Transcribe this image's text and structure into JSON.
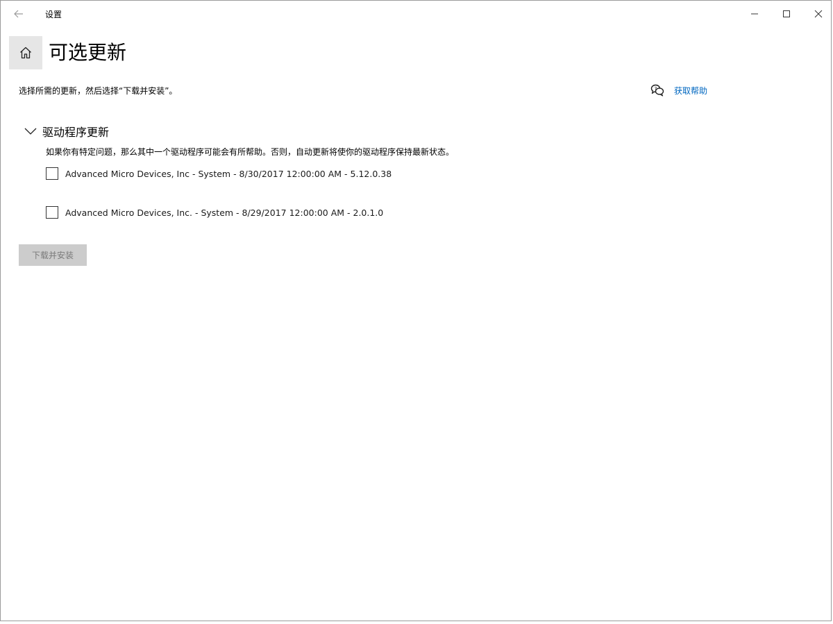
{
  "window": {
    "app_title": "设置"
  },
  "page": {
    "title": "可选更新",
    "subtitle": "选择所需的更新，然后选择“下载并安装”。",
    "help_link": "获取帮助"
  },
  "section": {
    "title": "驱动程序更新",
    "expanded": true,
    "description": "如果你有特定问题，那么其中一个驱动程序可能会有所帮助。否则，自动更新将使你的驱动程序保持最新状态。",
    "items": [
      {
        "label": "Advanced Micro Devices, Inc - System - 8/30/2017 12:00:00 AM - 5.12.0.38",
        "checked": false
      },
      {
        "label": "Advanced Micro Devices, Inc. - System - 8/29/2017 12:00:00 AM - 2.0.1.0",
        "checked": false
      }
    ]
  },
  "actions": {
    "install_label": "下载并安装",
    "install_enabled": false
  },
  "icons": {
    "back": "back-arrow-icon",
    "home": "home-icon",
    "help": "chat-help-icon",
    "chevron": "chevron-down-icon",
    "minimize": "minimize-icon",
    "maximize": "maximize-icon",
    "close": "close-icon"
  },
  "colors": {
    "link": "#0067c0",
    "home_tile_bg": "#e6e6e6",
    "disabled_button_bg": "#cccccc",
    "disabled_button_text": "#7a7a7a"
  }
}
